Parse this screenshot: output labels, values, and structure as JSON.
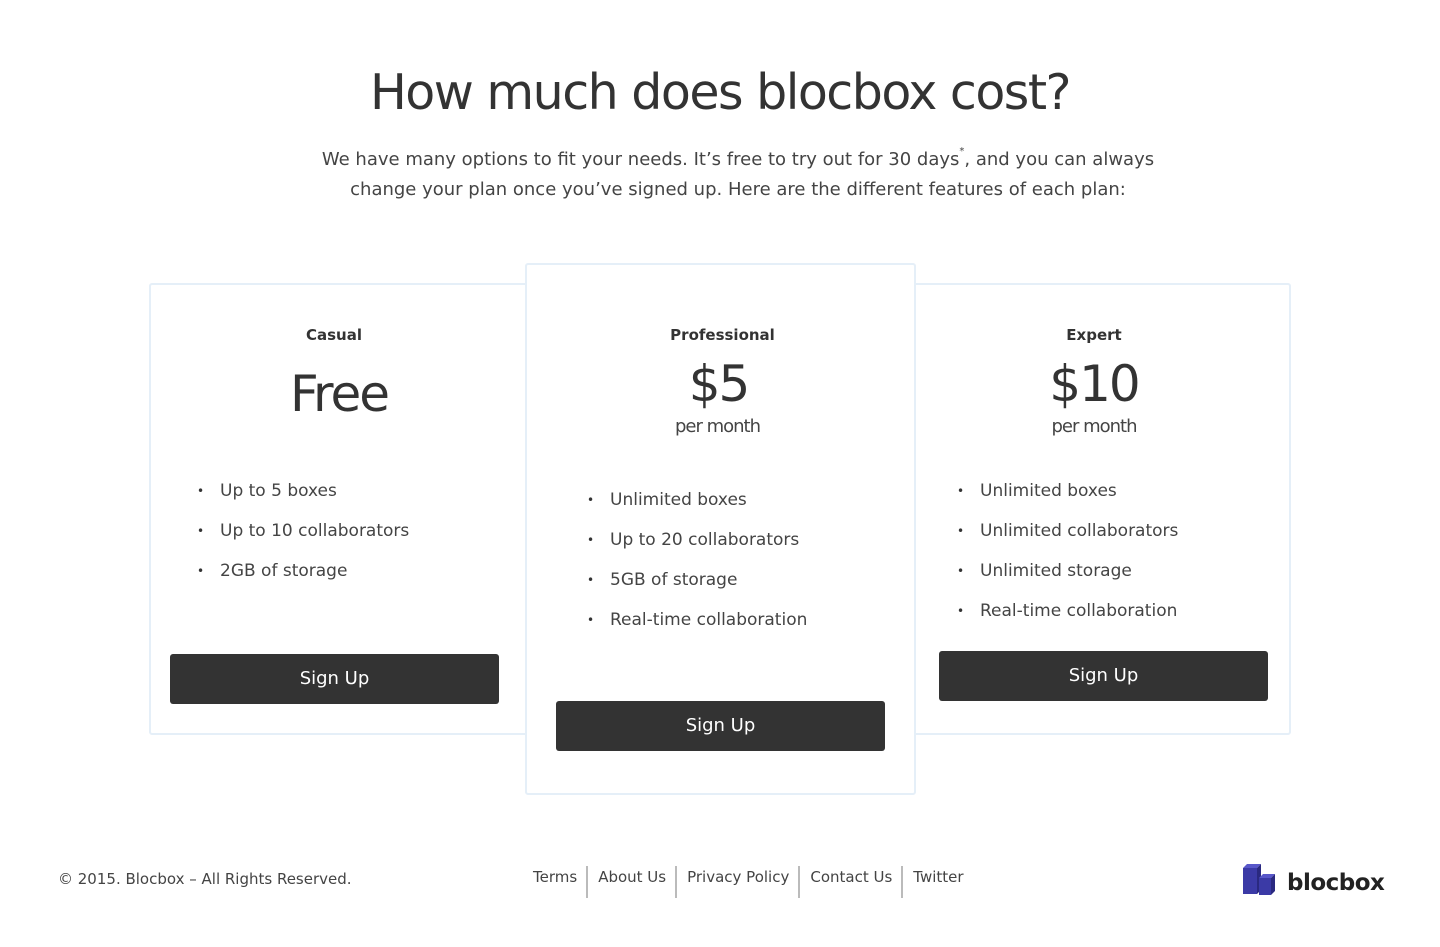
{
  "hero": {
    "title": "How much does blocbox cost?",
    "intro_line1_before": "We have many options to fit your needs. It’s free to try out for 30 days",
    "intro_sup": "*",
    "intro_line1_after": ", and you can always",
    "intro_line2": "change your plan once you’ve signed up. Here are the different features of each plan:"
  },
  "plans": [
    {
      "name": "Casual",
      "price": "Free",
      "period": "",
      "features": [
        "Up to 5 boxes",
        "Up to 10 collaborators",
        "2GB of storage"
      ],
      "cta": "Sign Up"
    },
    {
      "name": "Professional",
      "price": "$5",
      "period": "per month",
      "features": [
        "Unlimited boxes",
        "Up to 20 collaborators",
        "5GB of storage",
        "Real-time collaboration"
      ],
      "cta": "Sign Up"
    },
    {
      "name": "Expert",
      "price": "$10",
      "period": "per month",
      "features": [
        "Unlimited boxes",
        "Unlimited collaborators",
        "Unlimited storage",
        "Real-time collaboration"
      ],
      "cta": "Sign Up"
    }
  ],
  "bullet_glyph": "•",
  "footer": {
    "copyright": "© 2015. Blocbox – All Rights Reserved.",
    "links": [
      "Terms",
      "About Us",
      "Privacy Policy",
      "Contact Us",
      "Twitter"
    ],
    "brand": "blocbox"
  },
  "colors": {
    "button_bg": "#333333",
    "card_border": "#e5eff8",
    "logo_front": "#3b3aa6",
    "logo_top": "#5857c9"
  },
  "icons": {
    "logo": "blocbox-cubes-logo-icon"
  }
}
